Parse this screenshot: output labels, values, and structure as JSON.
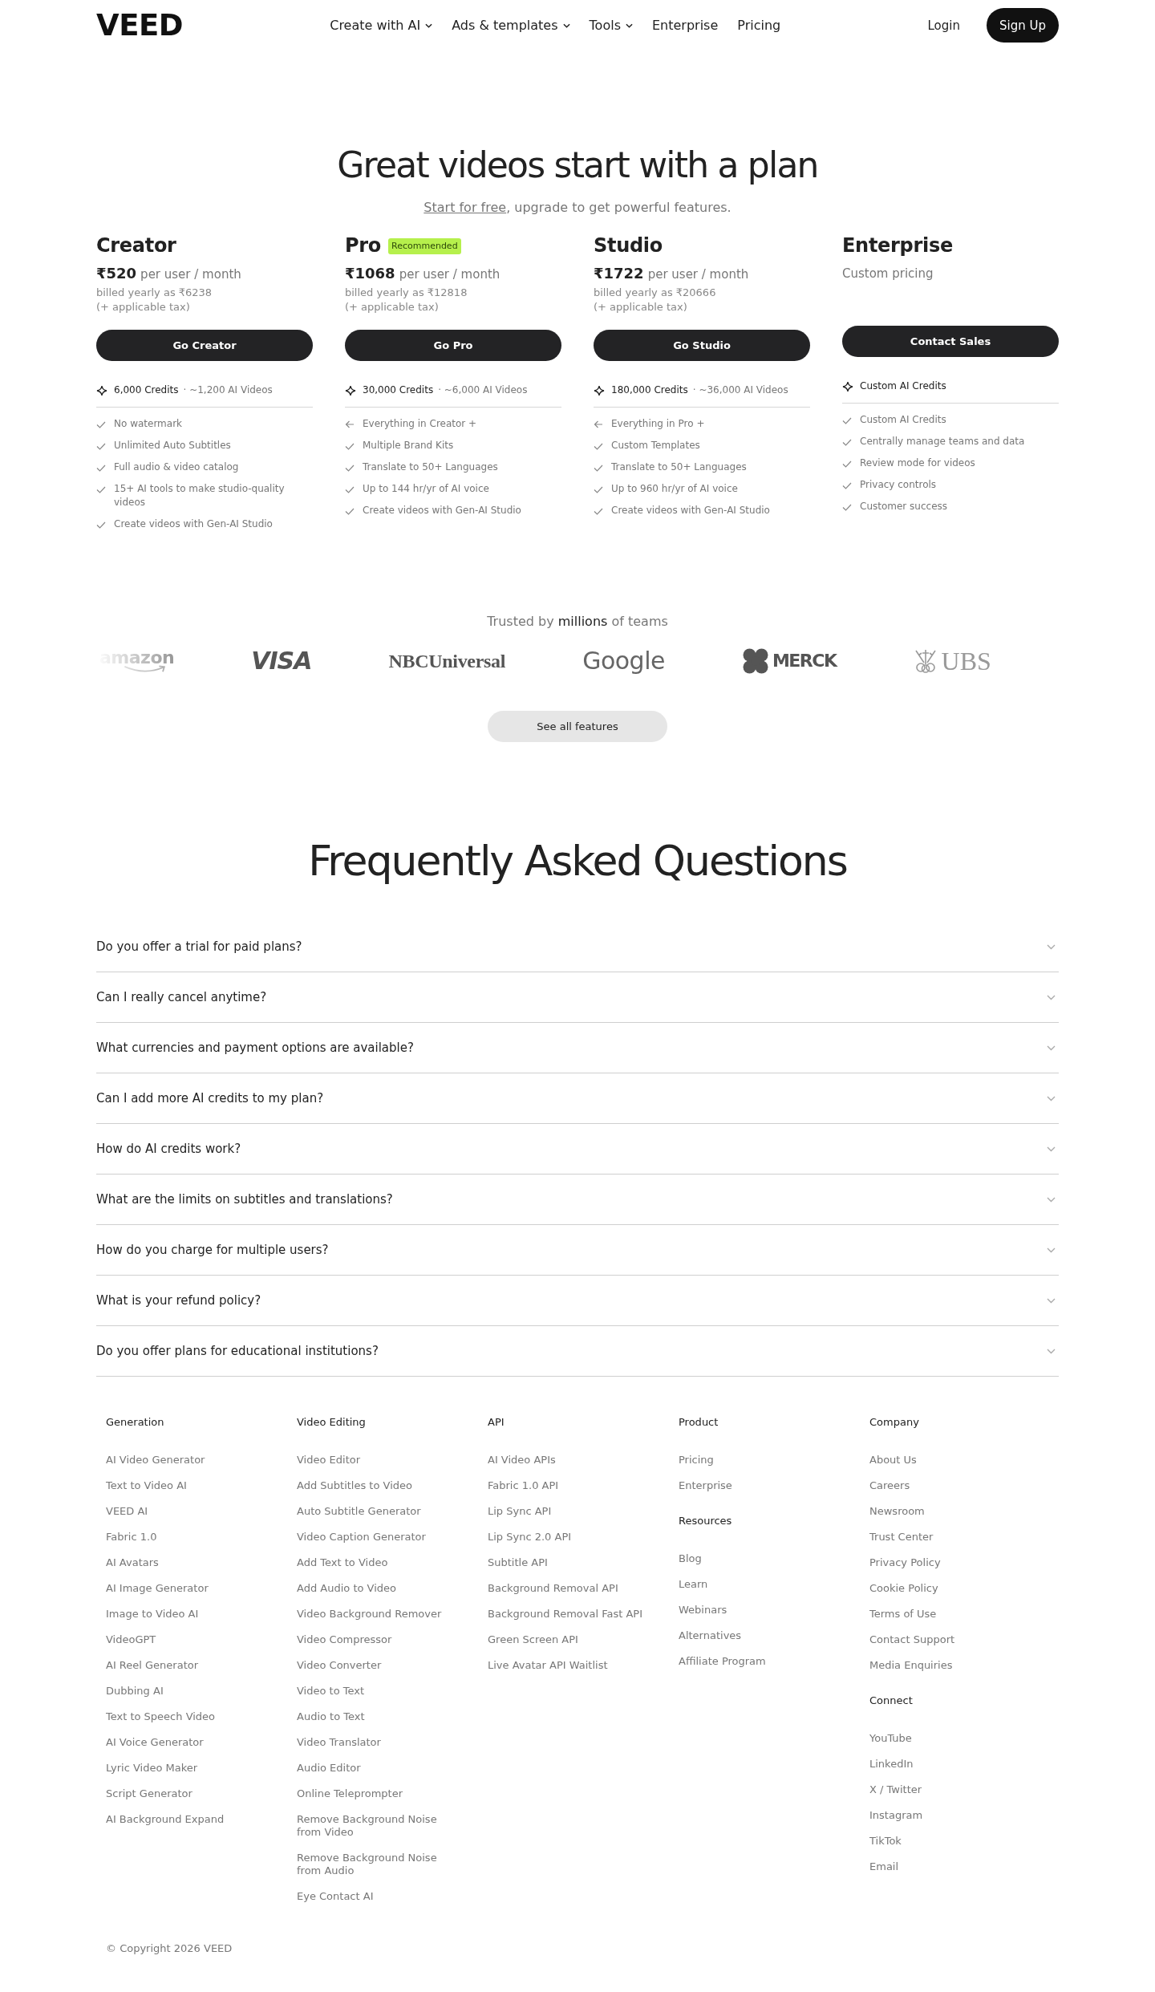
{
  "header": {
    "logo": "VEED",
    "nav": [
      {
        "label": "Create with AI",
        "dropdown": true
      },
      {
        "label": "Ads & templates",
        "dropdown": true
      },
      {
        "label": "Tools",
        "dropdown": true
      },
      {
        "label": "Enterprise",
        "dropdown": false
      },
      {
        "label": "Pricing",
        "dropdown": false
      }
    ],
    "login": "Login",
    "signup": "Sign Up"
  },
  "hero": {
    "title": "Great videos start with a plan",
    "subtitle_link": "Start for free",
    "subtitle_rest": ", upgrade to get powerful features."
  },
  "plans": [
    {
      "name": "Creator",
      "price": "₹520",
      "price_unit": "per user / month",
      "billed": "billed yearly as ₹6238",
      "tax": "(+ applicable tax)",
      "button": "Go Creator",
      "credits": "6,000 Credits",
      "videos": "· ~1,200 AI Videos",
      "features": [
        {
          "kind": "check",
          "text": "No watermark"
        },
        {
          "kind": "check",
          "text": "Unlimited Auto Subtitles"
        },
        {
          "kind": "check",
          "text": "Full audio & video catalog"
        },
        {
          "kind": "check",
          "text": "15+ AI tools to make studio-quality videos"
        },
        {
          "kind": "check",
          "text": "Create videos with Gen-AI Studio"
        }
      ]
    },
    {
      "name": "Pro",
      "badge": "Recommended",
      "price": "₹1068",
      "price_unit": "per user / month",
      "billed": "billed yearly as ₹12818",
      "tax": "(+ applicable tax)",
      "button": "Go Pro",
      "credits": "30,000 Credits",
      "videos": "· ~6,000 AI Videos",
      "features": [
        {
          "kind": "arrow",
          "text": "Everything in Creator +"
        },
        {
          "kind": "check",
          "text": "Multiple Brand Kits"
        },
        {
          "kind": "check",
          "text": "Translate to 50+ Languages"
        },
        {
          "kind": "check",
          "text": "Up to 144 hr/yr of AI voice"
        },
        {
          "kind": "check",
          "text": "Create videos with Gen-AI Studio"
        }
      ]
    },
    {
      "name": "Studio",
      "price": "₹1722",
      "price_unit": "per user / month",
      "billed": "billed yearly as ₹20666",
      "tax": "(+ applicable tax)",
      "button": "Go Studio",
      "credits": "180,000 Credits",
      "videos": "· ~36,000 AI Videos",
      "features": [
        {
          "kind": "arrow",
          "text": "Everything in Pro +"
        },
        {
          "kind": "check",
          "text": "Custom Templates"
        },
        {
          "kind": "check",
          "text": "Translate to 50+ Languages"
        },
        {
          "kind": "check",
          "text": "Up to 960 hr/yr of AI voice"
        },
        {
          "kind": "check",
          "text": "Create videos with Gen-AI Studio"
        }
      ]
    },
    {
      "name": "Enterprise",
      "price_note": "Custom pricing",
      "button": "Contact Sales",
      "credits": "Custom AI Credits",
      "features": [
        {
          "kind": "check",
          "text": "Custom AI Credits"
        },
        {
          "kind": "check",
          "text": "Centrally manage teams and data"
        },
        {
          "kind": "check",
          "text": "Review mode for videos"
        },
        {
          "kind": "check",
          "text": "Privacy controls"
        },
        {
          "kind": "check",
          "text": "Customer success"
        }
      ]
    }
  ],
  "trusted": {
    "text": "Trusted by **millions** of teams",
    "logos": [
      {
        "kind": "smile",
        "text": "amazon"
      },
      {
        "kind": "italic",
        "text": "VISA"
      },
      {
        "kind": "serif",
        "text": "NBCUniversal"
      },
      {
        "kind": "plain",
        "text": "Google"
      },
      {
        "kind": "symbol",
        "text": "MERCK"
      },
      {
        "kind": "keys",
        "text": "UBS"
      }
    ],
    "button": "See all features"
  },
  "faq": {
    "title": "Frequently Asked Questions",
    "questions": [
      "Do you offer a trial for paid plans?",
      "Can I really cancel anytime?",
      "What currencies and payment options are available?",
      "Can I add more AI credits to my plan?",
      "How do AI credits work?",
      "What are the limits on subtitles and translations?",
      "How do you charge for multiple users?",
      "What is your refund policy?",
      "Do you offer plans for educational institutions?"
    ]
  },
  "footer": {
    "columns": [
      {
        "sections": [
          {
            "heading": "Generation",
            "links": [
              "AI Video Generator",
              "Text to Video AI",
              "VEED AI",
              "Fabric 1.0",
              "AI Avatars",
              "AI Image Generator",
              "Image to Video AI",
              "VideoGPT",
              "AI Reel Generator",
              "Dubbing AI",
              "Text to Speech Video",
              "AI Voice Generator",
              "Lyric Video Maker",
              "Script Generator",
              "AI Background Expand"
            ]
          }
        ]
      },
      {
        "sections": [
          {
            "heading": "Video Editing",
            "links": [
              "Video Editor",
              "Add Subtitles to Video",
              "Auto Subtitle Generator",
              "Video Caption Generator",
              "Add Text to Video",
              "Add Audio to Video",
              "Video Background Remover",
              "Video Compressor",
              "Video Converter",
              "Video to Text",
              "Audio to Text",
              "Video Translator",
              "Audio Editor",
              "Online Teleprompter",
              "Remove Background Noise from Video",
              "Remove Background Noise from Audio",
              "Eye Contact AI"
            ]
          }
        ]
      },
      {
        "sections": [
          {
            "heading": "API",
            "links": [
              "AI Video APIs",
              "Fabric 1.0 API",
              "Lip Sync API",
              "Lip Sync 2.0 API",
              "Subtitle API",
              "Background Removal API",
              "Background Removal Fast API",
              "Green Screen API",
              "Live Avatar API Waitlist"
            ]
          }
        ]
      },
      {
        "sections": [
          {
            "heading": "Product",
            "links": [
              "Pricing",
              "Enterprise"
            ]
          },
          {
            "heading": "Resources",
            "links": [
              "Blog",
              "Learn",
              "Webinars",
              "Alternatives",
              "Affiliate Program"
            ]
          }
        ]
      },
      {
        "sections": [
          {
            "heading": "Company",
            "links": [
              "About Us",
              "Careers",
              "Newsroom",
              "Trust Center",
              "Privacy Policy",
              "Cookie Policy",
              "Terms of Use",
              "Contact Support",
              "Media Enquiries"
            ]
          },
          {
            "heading": "Connect",
            "links": [
              "YouTube",
              "LinkedIn",
              "X / Twitter",
              "Instagram",
              "TikTok",
              "Email"
            ]
          }
        ]
      }
    ],
    "copyright": "© Copyright 2026 VEED"
  }
}
